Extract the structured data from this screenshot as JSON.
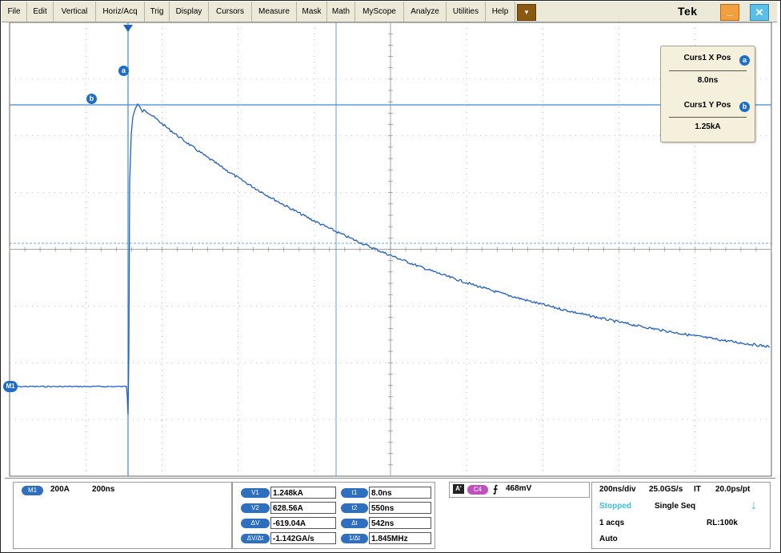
{
  "menu": {
    "items": [
      "File",
      "Edit",
      "Vertical",
      "Horiz/Acq",
      "Trig",
      "Display",
      "Cursors",
      "Measure",
      "Mask",
      "Math",
      "MyScope",
      "Analyze",
      "Utilities",
      "Help"
    ],
    "brand": "Tek",
    "dropdown_glyph": "▾",
    "minimize_glyph": "_",
    "close_glyph": "✕"
  },
  "markers": {
    "cursor_a": "a",
    "cursor_b": "b",
    "channel_ref": "M1"
  },
  "cursor_readout": {
    "x_label": "Curs1 X Pos",
    "x_value": "8.0ns",
    "y_label": "Curs1 Y Pos",
    "y_value": "1.25kA"
  },
  "channel_panel": {
    "badge": "M1",
    "scale": "200A",
    "timebase": "200ns"
  },
  "measure_panel": {
    "left_labels": [
      "V1",
      "V2",
      "ΔV",
      "ΔV/Δt"
    ],
    "left_values": [
      "1.248kA",
      "628.56A",
      "-619.04A",
      "-1.142GA/s"
    ],
    "right_labels": [
      "t1",
      "t2",
      "Δt",
      "1/Δt"
    ],
    "right_values": [
      "8.0ns",
      "550ns",
      "542ns",
      "1.845MHz"
    ]
  },
  "trigger_panel": {
    "mode_badge": "A'",
    "source_badge": "C4",
    "slope_glyph": "⨍",
    "level": "468mV"
  },
  "acq_panel": {
    "horiz": "200ns/div",
    "rate": "25.0GS/s",
    "mode": "IT",
    "res": "20.0ps/pt",
    "state": "Stopped",
    "seq": "Single Seq",
    "acqs": "1 acqs",
    "rl": "RL:100k",
    "trigger": "Auto",
    "arrow_glyph": "↓"
  },
  "colors": {
    "trace": "#1f5fc4",
    "grid": "#8a8a8a",
    "cursor_line": "#3a8ad8",
    "stopped": "#36c0e0"
  }
}
